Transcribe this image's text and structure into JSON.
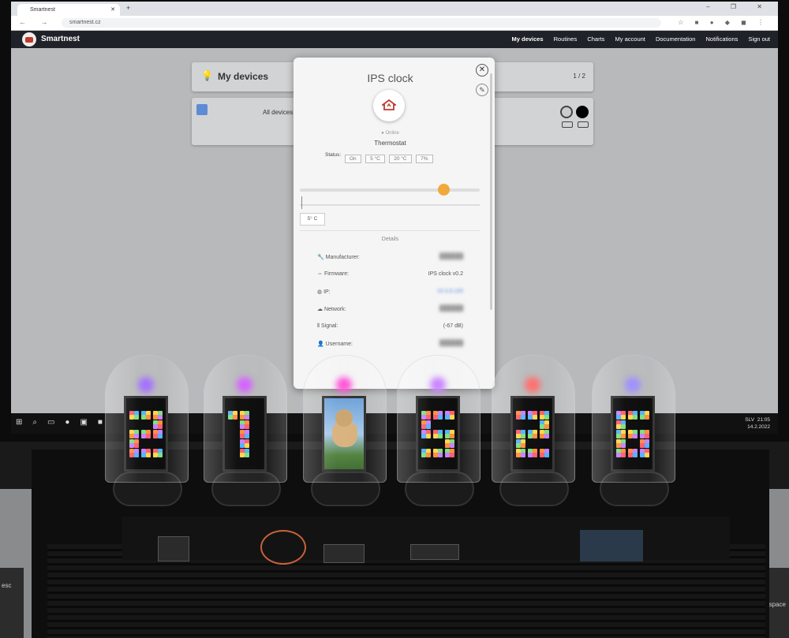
{
  "browser": {
    "tab_title": "Smartnest",
    "url": "smartnest.cz"
  },
  "site": {
    "brand": "Smartnest",
    "nav": [
      "My devices",
      "Routines",
      "Charts",
      "My account",
      "Documentation",
      "Notifications",
      "Sign out"
    ]
  },
  "devices_page": {
    "title": "My devices",
    "pagination": "1 / 2",
    "all_devices": "All devices"
  },
  "modal": {
    "title": "IPS clock",
    "state": "Online",
    "device_type": "Thermostat",
    "status_label": "Status:",
    "status_chips": [
      "On",
      "5 °C",
      "20 °C",
      "7%"
    ],
    "slider_value": 0.8,
    "temperature": "5° C",
    "details_header": "Details",
    "details": [
      {
        "label": "Manufacturer:",
        "value": "",
        "style": "blur"
      },
      {
        "label": "Firmware:",
        "value": "IPS clock v0.2",
        "style": "plain"
      },
      {
        "label": "IP:",
        "value": "10.3.9.100",
        "style": "ip"
      },
      {
        "label": "Network:",
        "value": "",
        "style": "blur"
      },
      {
        "label": "Signal:",
        "value": "(-67 dB)",
        "style": "plain"
      },
      {
        "label": "Username:",
        "value": "",
        "style": "blur"
      }
    ]
  },
  "taskbar": {
    "lang": "SLV",
    "time": "21:05",
    "date": "14.2.2022"
  },
  "keyboard": {
    "esc": "esc",
    "space": "space"
  },
  "clock": {
    "digits": [
      "2",
      "1",
      "dog",
      "5",
      "2",
      "6"
    ]
  }
}
